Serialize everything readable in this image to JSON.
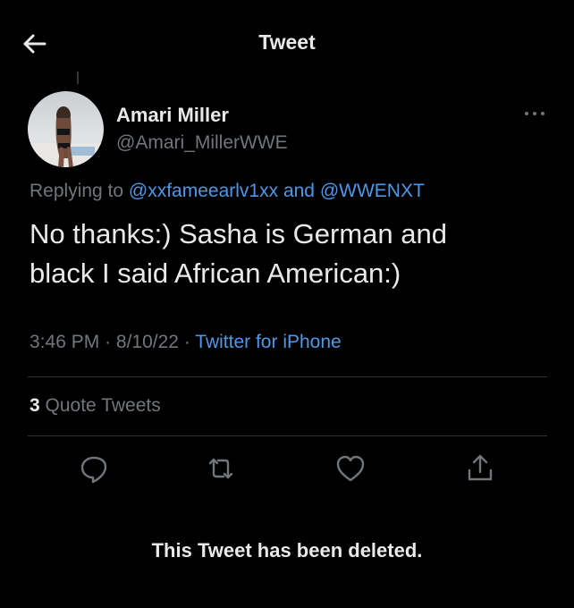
{
  "header": {
    "title": "Tweet",
    "back_icon": "arrow-left-icon"
  },
  "tweet": {
    "author_name": "Amari Miller",
    "author_handle": "@Amari_MillerWWE",
    "replying_prefix": "Replying to",
    "reply_to_1": "@xxfameearlv1xx",
    "reply_joiner": "and",
    "reply_to_2": "@WWENXT",
    "text": "No thanks:) Sasha is German and\nblack I said African American:)",
    "time": "3:46 PM",
    "date": "8/10/22",
    "source": "Twitter for iPhone",
    "separator": "·"
  },
  "stats": {
    "quote_count": "3",
    "quote_label": "Quote Tweets"
  },
  "actions": [
    "reply-icon",
    "retweet-icon",
    "like-icon",
    "share-icon"
  ],
  "footer": {
    "deleted_notice": "This Tweet has been deleted."
  },
  "colors": {
    "background": "#000000",
    "text": "#e7e9ea",
    "muted": "#71767b",
    "link": "#4e98e6",
    "divider": "#2f3336"
  }
}
